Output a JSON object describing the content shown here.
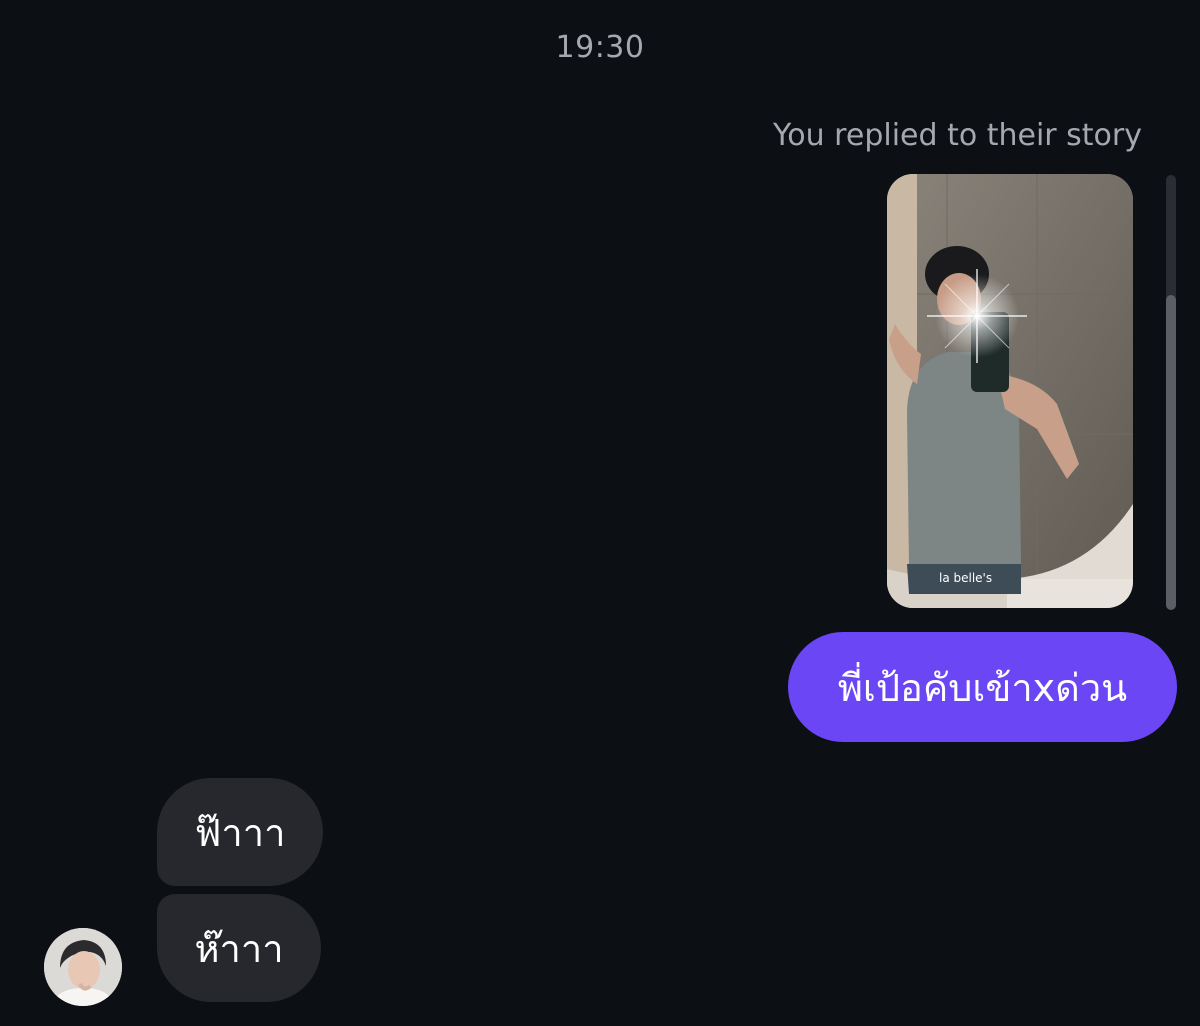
{
  "conversation": {
    "timestamp": "19:30",
    "story_reply_label": "You replied to their story",
    "story_thumbnail": {
      "icon": "story-photo",
      "caption_text": "la belle's"
    },
    "messages": [
      {
        "sender": "me",
        "text": "พี่เป้อคับเข้าxด่วน"
      },
      {
        "sender": "them",
        "text": "ฟ๊าาา"
      },
      {
        "sender": "them",
        "text": "ห๊าาา"
      }
    ]
  },
  "colors": {
    "background": "#0c0f14",
    "outgoing_bubble": "#6a46f4",
    "incoming_bubble": "#26282d",
    "meta_text": "#a5a8ae"
  }
}
